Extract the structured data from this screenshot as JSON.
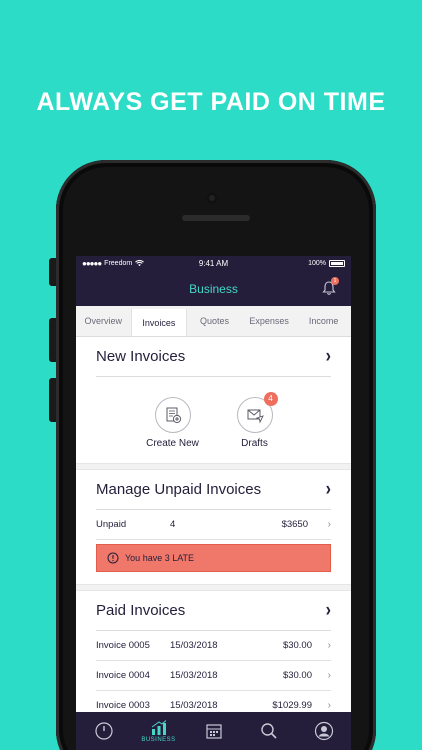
{
  "headline": "ALWAYS GET PAID ON TIME",
  "status": {
    "carrier": "Freedom",
    "time": "9:41 AM",
    "battery": "100%"
  },
  "nav": {
    "title": "Business",
    "notification_count": "1"
  },
  "tabs": [
    {
      "label": "Overview",
      "active": false
    },
    {
      "label": "Invoices",
      "active": true
    },
    {
      "label": "Quotes",
      "active": false
    },
    {
      "label": "Expenses",
      "active": false
    },
    {
      "label": "Income",
      "active": false
    }
  ],
  "new_invoices": {
    "title": "New Invoices",
    "create_label": "Create New",
    "drafts_label": "Drafts",
    "drafts_count": "4"
  },
  "unpaid": {
    "title": "Manage Unpaid Invoices",
    "label": "Unpaid",
    "count": "4",
    "amount": "$3650",
    "late_message": "You have 3 LATE"
  },
  "paid": {
    "title": "Paid Invoices",
    "rows": [
      {
        "name": "Invoice 0005",
        "date": "15/03/2018",
        "amount": "$30.00"
      },
      {
        "name": "Invoice 0004",
        "date": "15/03/2018",
        "amount": "$30.00"
      },
      {
        "name": "Invoice 0003",
        "date": "15/03/2018",
        "amount": "$1029.99"
      }
    ]
  },
  "bottom_nav": {
    "business_label": "BUSINESS"
  },
  "colors": {
    "background": "#2ddcc6",
    "dark": "#241e3a",
    "accent": "#46d7c7",
    "alert": "#f0786a"
  }
}
